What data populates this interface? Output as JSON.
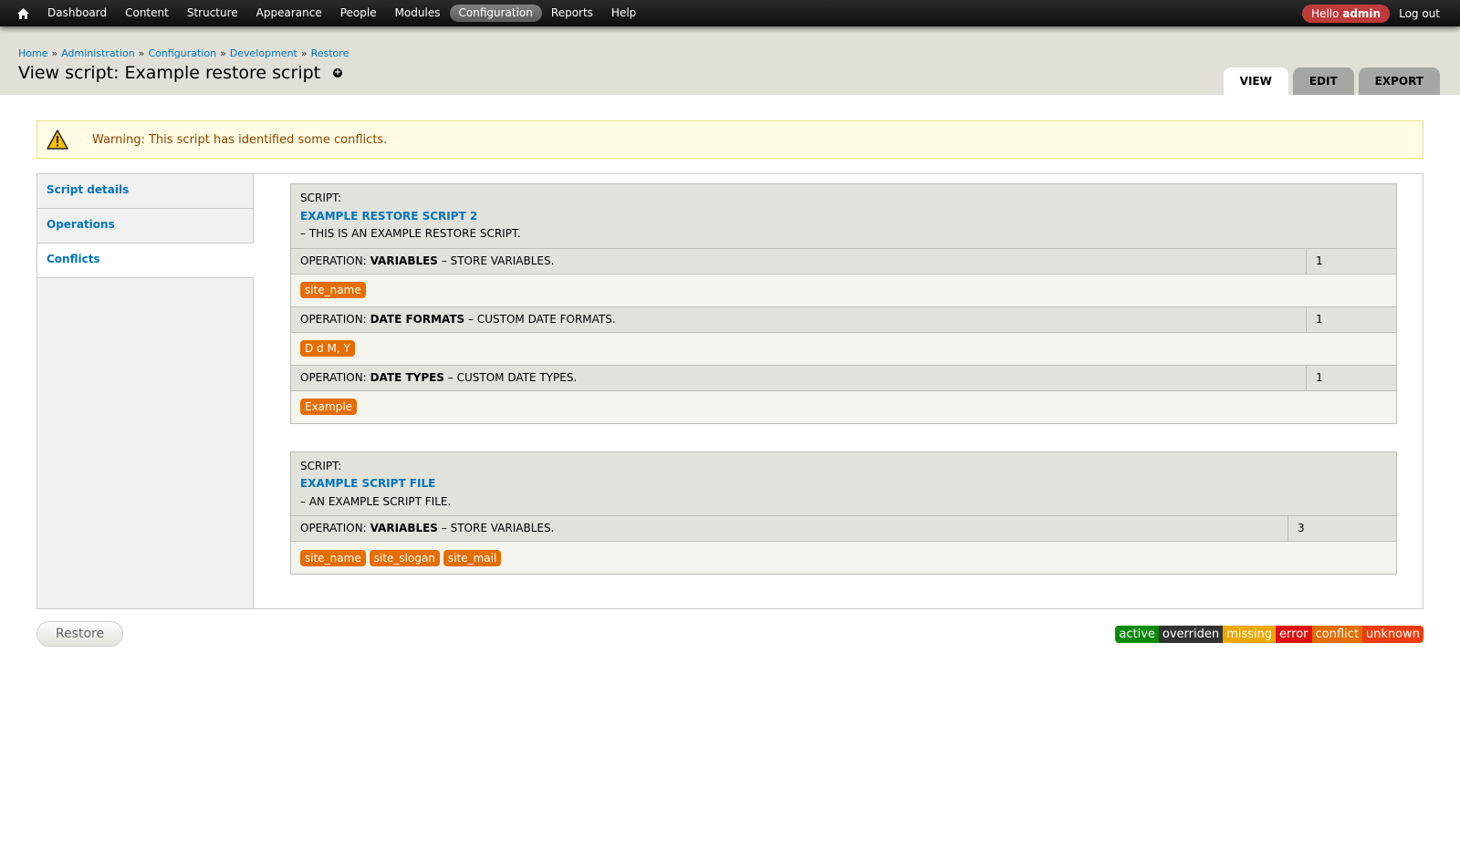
{
  "toolbar": {
    "menu": [
      "Dashboard",
      "Content",
      "Structure",
      "Appearance",
      "People",
      "Modules",
      "Configuration",
      "Reports",
      "Help"
    ],
    "active": "Configuration",
    "hello_prefix": "Hello",
    "user": "admin",
    "logout": "Log out"
  },
  "breadcrumb": [
    "Home",
    "Administration",
    "Configuration",
    "Development",
    "Restore"
  ],
  "breadcrumb_sep": "»",
  "page_title": "View script: Example restore script",
  "tabs": [
    {
      "label": "VIEW",
      "active": true
    },
    {
      "label": "EDIT",
      "active": false
    },
    {
      "label": "EXPORT",
      "active": false
    }
  ],
  "warning": "Warning: This script has identified some conflicts.",
  "vtabs": [
    {
      "label": "Script details",
      "selected": false
    },
    {
      "label": "Operations",
      "selected": false
    },
    {
      "label": "Conflicts",
      "selected": true
    }
  ],
  "scripts": [
    {
      "prefix": "SCRIPT:",
      "name": "EXAMPLE RESTORE SCRIPT 2",
      "desc": "– THIS IS AN EXAMPLE RESTORE SCRIPT.",
      "operations": [
        {
          "prefix": "OPERATION:",
          "name": "VARIABLES",
          "desc": "– STORE VARIABLES.",
          "count": "1",
          "items": [
            "site_name"
          ]
        },
        {
          "prefix": "OPERATION:",
          "name": "DATE FORMATS",
          "desc": "– CUSTOM DATE FORMATS.",
          "count": "1",
          "items": [
            "D d M, Y"
          ]
        },
        {
          "prefix": "OPERATION:",
          "name": "DATE TYPES",
          "desc": "– CUSTOM DATE TYPES.",
          "count": "1",
          "items": [
            "Example"
          ]
        }
      ]
    },
    {
      "prefix": "SCRIPT:",
      "name": "EXAMPLE SCRIPT FILE",
      "desc": "– AN EXAMPLE SCRIPT FILE.",
      "operations": [
        {
          "prefix": "OPERATION:",
          "name": "VARIABLES",
          "desc": "– STORE VARIABLES.",
          "count": "3",
          "items": [
            "site_name",
            "site_slogan",
            "site_mail"
          ]
        }
      ]
    }
  ],
  "restore_button": "Restore",
  "legend": [
    {
      "label": "active",
      "color": "#0a8a0a"
    },
    {
      "label": "overriden",
      "color": "#333333"
    },
    {
      "label": "missing",
      "color": "#f0a800"
    },
    {
      "label": "error",
      "color": "#e01010"
    },
    {
      "label": "conflict",
      "color": "#e66d00"
    },
    {
      "label": "unknown",
      "color": "#f03c0c"
    }
  ],
  "colors": {
    "link": "#0074bd",
    "tag": "#e66d00",
    "warning_bg": "#fffce3"
  }
}
